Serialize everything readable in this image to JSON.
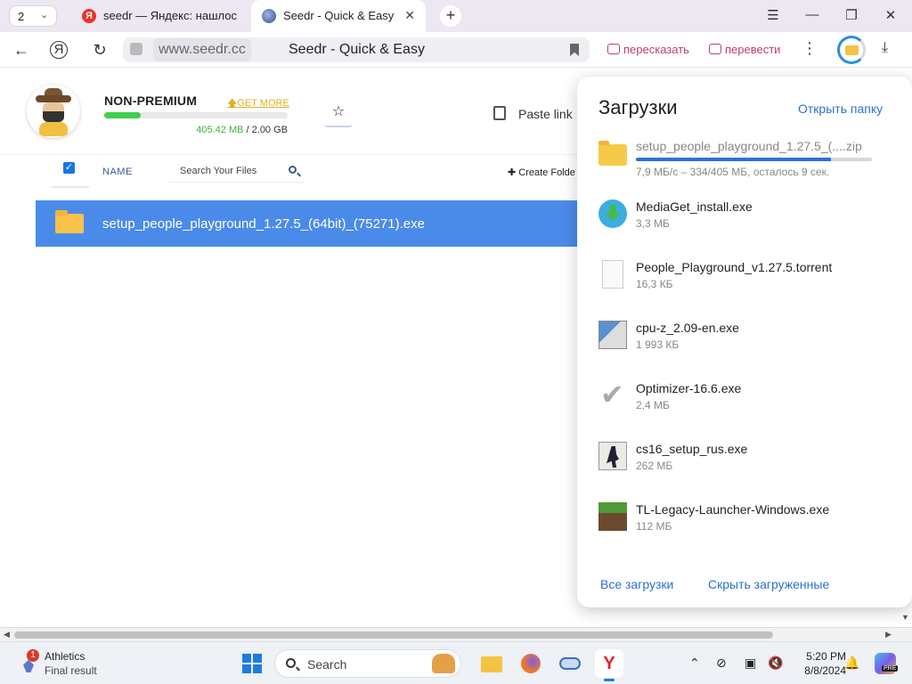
{
  "browser": {
    "tab_count": "2",
    "tabs": [
      {
        "title": "seedr — Яндекс: нашлось"
      },
      {
        "title": "Seedr - Quick & Easy",
        "close": "✕"
      }
    ],
    "new_tab": "+",
    "window_controls": {
      "menu": "☰",
      "minimize": "—",
      "restore": "❐",
      "close": "✕"
    },
    "address": {
      "domain": "www.seedr.cc",
      "page_title": "Seedr - Quick & Easy"
    },
    "ext_retell": "пересказать",
    "ext_translate": "перевести",
    "kebab": "⋮",
    "download_arrow": "⤓"
  },
  "seedr": {
    "plan": "NON-PREMIUM",
    "get_more": "GET MORE",
    "quota_used": "405.42 MB",
    "quota_sep": " / ",
    "quota_total": "2.00 GB",
    "quota_fraction": 0.198,
    "star": "☆",
    "paste_link": "Paste link",
    "select_all_check": "✓",
    "name_col": "NAME",
    "search_placeholder": "Search Your Files",
    "create_folder": "✚ Create Folde",
    "file": {
      "name": "setup_people_playground_1.27.5_(64bit)_(75271).exe"
    }
  },
  "downloads": {
    "title": "Загрузки",
    "open_folder": "Открыть папку",
    "items": [
      {
        "name": "setup_people_playground_1.27.5_(....zip",
        "size": "7,9 МБ/с – 334/405 МБ, осталось 9 сек.",
        "icon": "zip-folder-icon",
        "progress": 0.825
      },
      {
        "name": "MediaGet_install.exe",
        "size": "3,3 МБ",
        "icon": "mediaget-icon"
      },
      {
        "name": "People_Playground_v1.27.5.torrent",
        "size": "16,3 КБ",
        "icon": "document-icon"
      },
      {
        "name": "cpu-z_2.09-en.exe",
        "size": "1 993 КБ",
        "icon": "installer-icon"
      },
      {
        "name": "Optimizer-16.6.exe",
        "size": "2,4 МБ",
        "icon": "checkmark-icon"
      },
      {
        "name": "cs16_setup_rus.exe",
        "size": "262 МБ",
        "icon": "counter-strike-icon"
      },
      {
        "name": "TL-Legacy-Launcher-Windows.exe",
        "size": "112 МБ",
        "icon": "minecraft-grass-icon"
      }
    ],
    "all_downloads": "Все загрузки",
    "hide_finished": "Скрыть загруженные"
  },
  "taskbar": {
    "weather_badge": "1",
    "widget_title": "Athletics",
    "widget_subtitle": "Final result",
    "search_placeholder": "Search",
    "time": "5:20 PM",
    "date": "8/8/2024",
    "copilot_badge": "PRE"
  },
  "colors": {
    "accent": "#4a8bea",
    "link": "#2c6fcf",
    "quota_fill": "#3ecf4e",
    "progress": "#2e6fd8"
  }
}
